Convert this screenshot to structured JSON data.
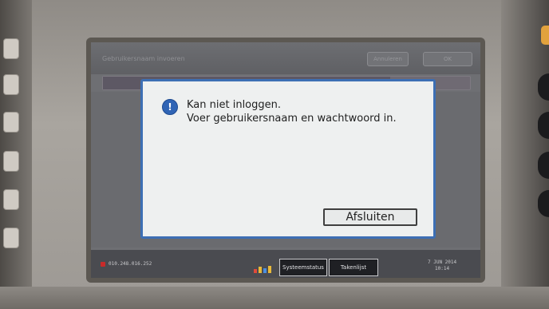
{
  "header": {
    "title": "Gebruikersnaam invoeren",
    "cancel_label": "Annuleren",
    "ok_label": "OK"
  },
  "dialog": {
    "line1": "Kan niet inloggen.",
    "line2": "Voer gebruikersnaam en wachtwoord in.",
    "close_label": "Afsluiten",
    "icon": "info-icon"
  },
  "status_bar": {
    "ip_address": "010.248.016.252",
    "system_status_tab": "Systeemstatus",
    "job_list_tab": "Takenlijst",
    "date": "7 JUN  2014",
    "time": "10:14"
  },
  "colors": {
    "dialog_border": "#3d6fb4",
    "dialog_bg": "#eef0f0",
    "screen_bg": "#6e6f73",
    "status_bar_bg": "#4a4b50"
  }
}
